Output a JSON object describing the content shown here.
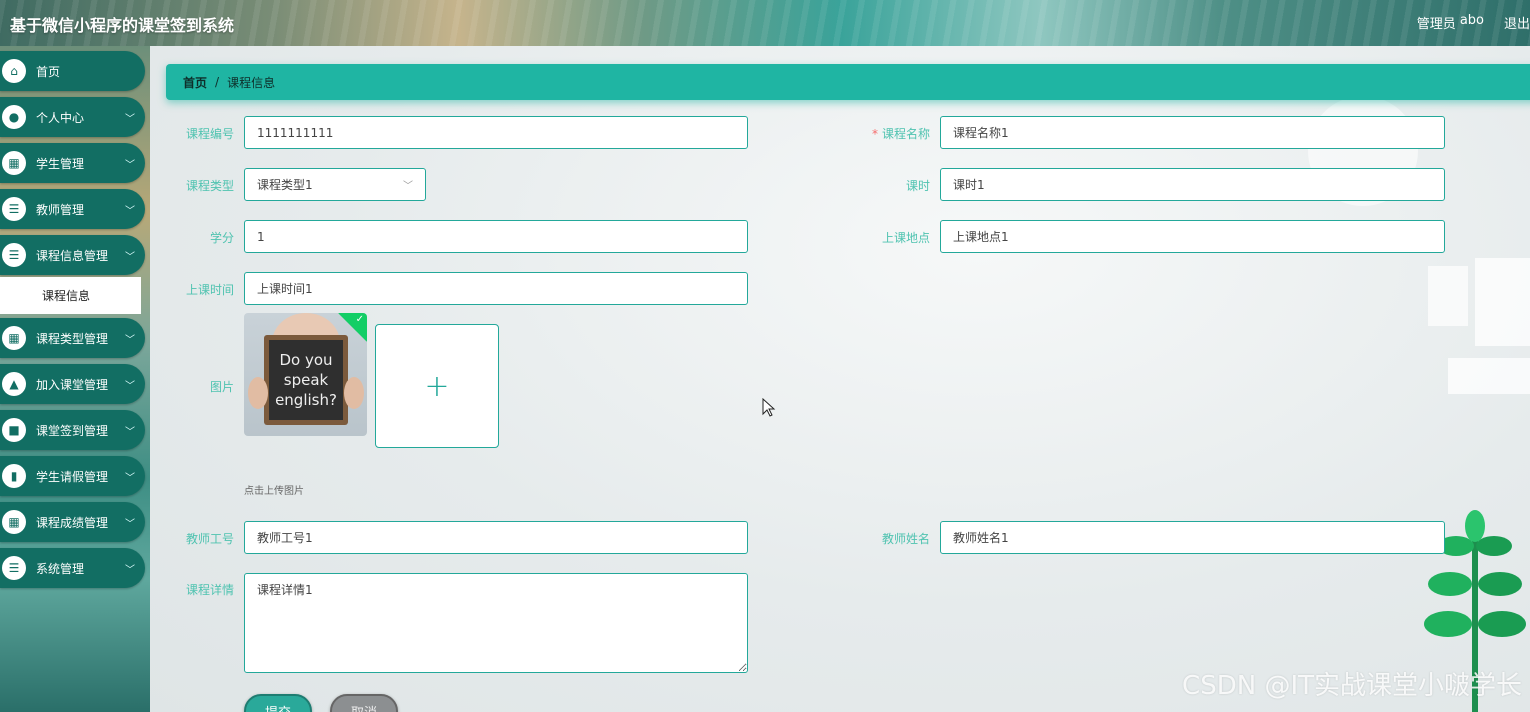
{
  "header": {
    "title": "基于微信小程序的课堂签到系统",
    "user_role": "管理员",
    "user_name": "abo",
    "logout": "退出"
  },
  "sidebar": {
    "items": [
      {
        "label": "首页",
        "icon": "home-icon",
        "chevron": false
      },
      {
        "label": "个人中心",
        "icon": "user-icon",
        "chevron": true
      },
      {
        "label": "学生管理",
        "icon": "grid-icon",
        "chevron": true
      },
      {
        "label": "教师管理",
        "icon": "list-icon",
        "chevron": true
      },
      {
        "label": "课程信息管理",
        "icon": "list-icon",
        "chevron": true
      },
      {
        "label": "课程类型管理",
        "icon": "grid-icon",
        "chevron": true
      },
      {
        "label": "加入课堂管理",
        "icon": "chart-icon",
        "chevron": true
      },
      {
        "label": "课堂签到管理",
        "icon": "monitor-icon",
        "chevron": true
      },
      {
        "label": "学生请假管理",
        "icon": "book-icon",
        "chevron": true
      },
      {
        "label": "课程成绩管理",
        "icon": "grid-icon",
        "chevron": true
      },
      {
        "label": "系统管理",
        "icon": "list-icon",
        "chevron": true
      }
    ],
    "submenu": {
      "label": "课程信息"
    }
  },
  "breadcrumb": {
    "home": "首页",
    "separator": "/",
    "current": "课程信息"
  },
  "form": {
    "course_no": {
      "label": "课程编号",
      "value": "1111111111"
    },
    "course_name": {
      "label": "课程名称",
      "value": "课程名称1",
      "required": "*"
    },
    "course_type": {
      "label": "课程类型",
      "value": "课程类型1"
    },
    "hours": {
      "label": "课时",
      "value": "课时1"
    },
    "credit": {
      "label": "学分",
      "value": "1"
    },
    "location": {
      "label": "上课地点",
      "value": "上课地点1"
    },
    "class_time": {
      "label": "上课时间",
      "value": "上课时间1"
    },
    "image": {
      "label": "图片",
      "tip": "点击上传图片",
      "thumb_text": [
        "Do you",
        "speak",
        "english?"
      ]
    },
    "teacher_no": {
      "label": "教师工号",
      "value": "教师工号1"
    },
    "teacher_name": {
      "label": "教师姓名",
      "value": "教师姓名1"
    },
    "detail": {
      "label": "课程详情",
      "value": "课程详情1"
    },
    "submit": "提交",
    "cancel": "取消"
  },
  "watermark": "CSDN @IT实战课堂小啵学长",
  "colors": {
    "accent": "#1fb5a3",
    "sidebar_item": "#126e63",
    "label": "#4fc3b0",
    "required": "#f56c6c"
  }
}
